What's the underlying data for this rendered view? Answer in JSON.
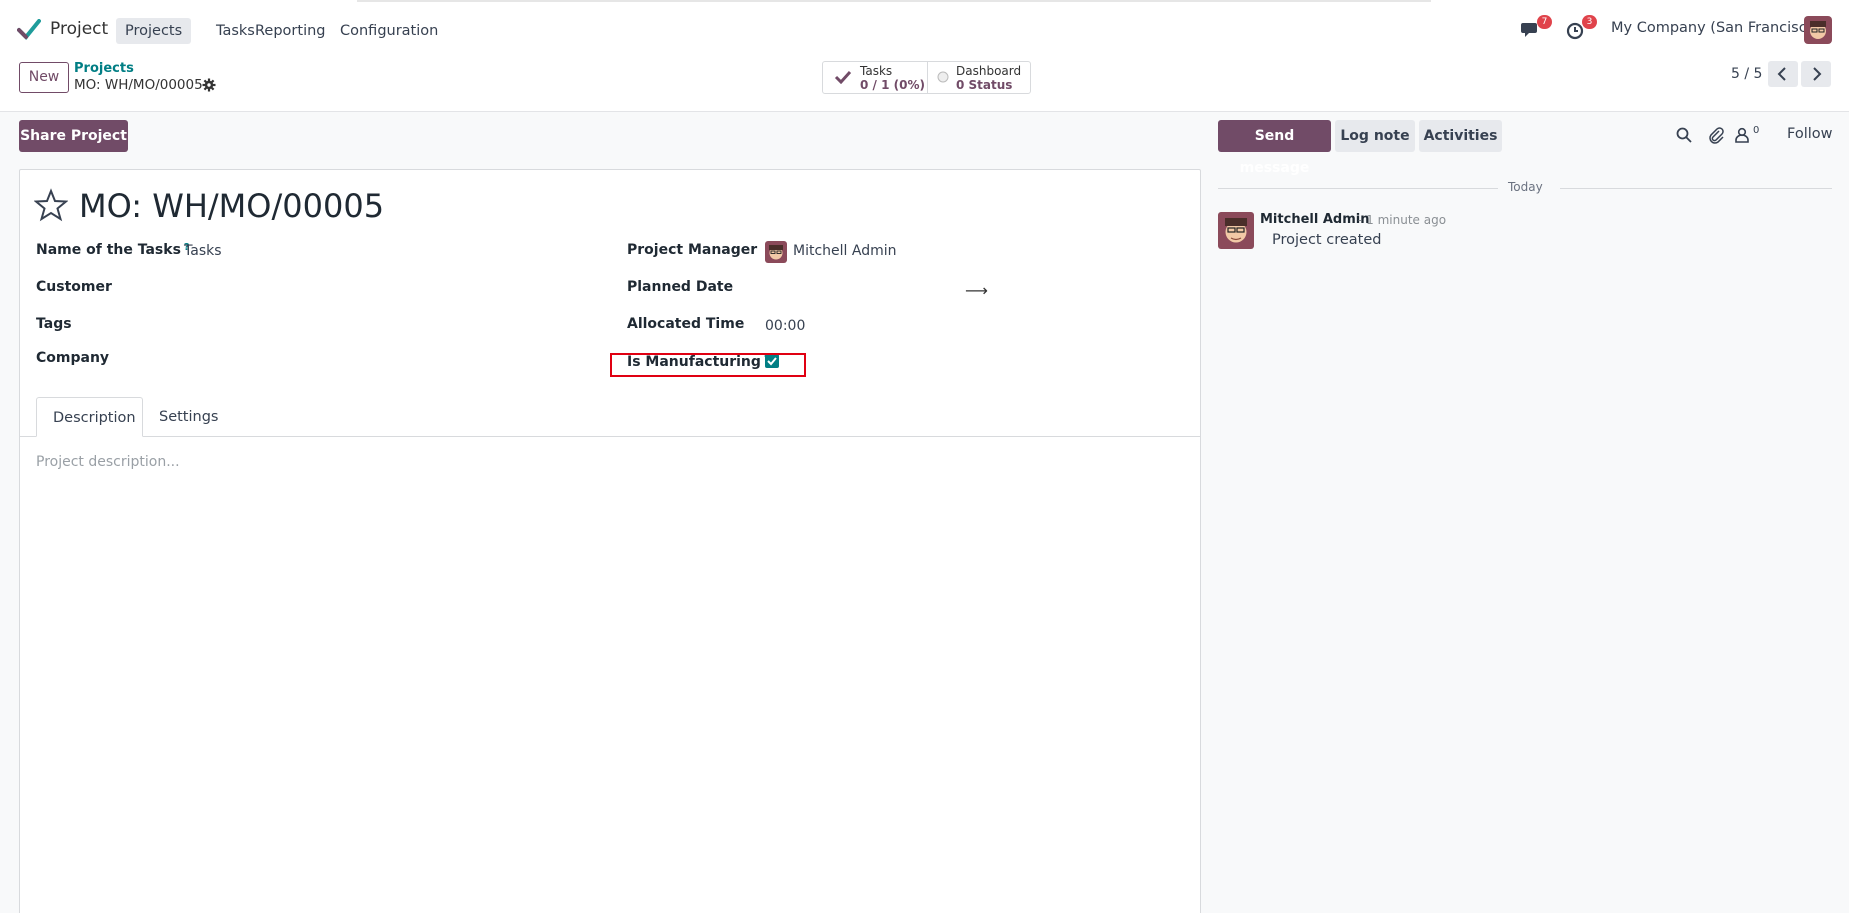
{
  "app": {
    "name": "Project"
  },
  "nav": {
    "items": [
      {
        "label": "Projects",
        "active": true
      },
      {
        "label": "Tasks",
        "active": false
      },
      {
        "label": "Reporting",
        "active": false
      },
      {
        "label": "Configuration",
        "active": false
      }
    ],
    "messages_badge": "7",
    "activities_badge": "3",
    "company": "My Company (San Francisco)"
  },
  "control": {
    "new_label": "New",
    "breadcrumb_parent": "Projects",
    "breadcrumb_current": "MO: WH/MO/00005",
    "smart_tasks_label": "Tasks",
    "smart_tasks_value": "0 / 1 (0%)",
    "smart_dashboard_label": "Dashboard",
    "smart_dashboard_value": "0 Status",
    "pager": "5 / 5"
  },
  "form": {
    "share_label": "Share Project",
    "title": "MO: WH/MO/00005",
    "fields": {
      "tasks_name_label": "Name of the Tasks",
      "tasks_name_value": "Tasks",
      "customer_label": "Customer",
      "tags_label": "Tags",
      "company_label": "Company",
      "manager_label": "Project Manager",
      "manager_value": "Mitchell Admin",
      "planned_label": "Planned Date",
      "allocated_label": "Allocated Time",
      "allocated_value": "00:00",
      "manufacturing_label": "Is Manufacturing",
      "manufacturing_checked": true,
      "help_mark": "?"
    },
    "tabs": [
      {
        "label": "Description",
        "active": true
      },
      {
        "label": "Settings",
        "active": false
      }
    ],
    "description_placeholder": "Project description..."
  },
  "chatter": {
    "send_label": "Send message",
    "log_label": "Log note",
    "activities_label": "Activities",
    "followers_count": "0",
    "follow_label": "Follow",
    "date_separator": "Today",
    "message": {
      "author": "Mitchell Admin",
      "time": "- 1 minute ago",
      "body": "Project created"
    }
  },
  "colors": {
    "brand": "#714b67",
    "accent": "#017e84",
    "highlight": "#e00012"
  }
}
